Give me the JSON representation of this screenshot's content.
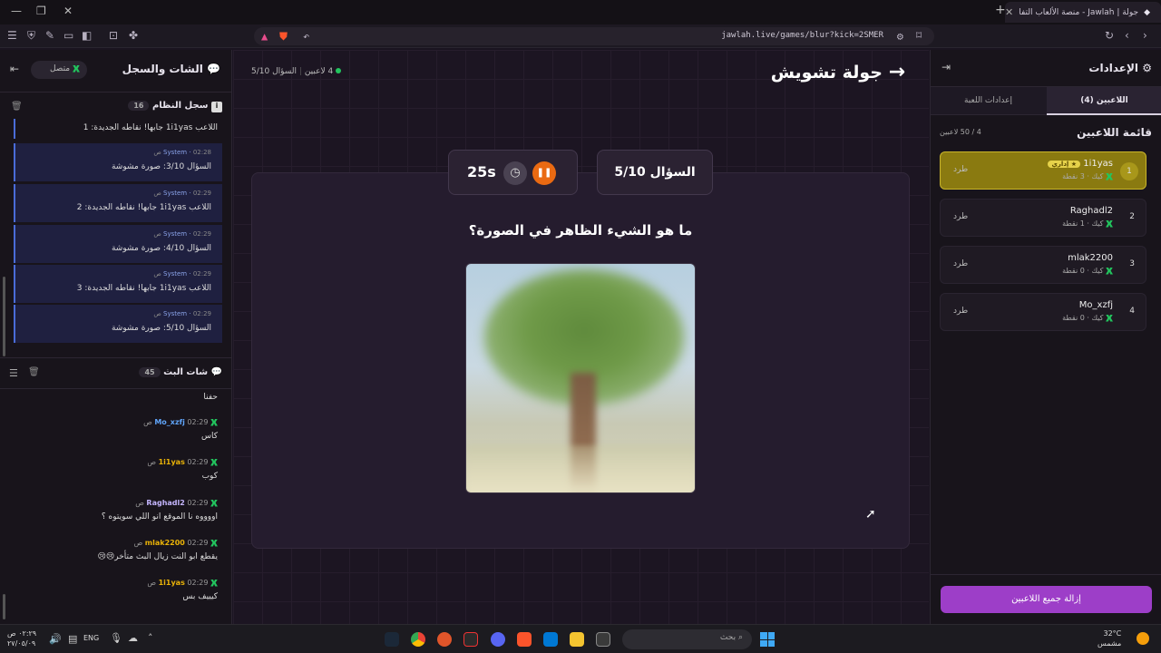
{
  "browser": {
    "tab_title": "جولة | Jawlah - منصة الألعاب التفا",
    "url": "jawlah.live/games/blur?kick=2SMER"
  },
  "settings": {
    "title": "الإعدادات",
    "tabs": [
      "اللاعبين (4)",
      "إعدادات اللعبة"
    ],
    "list_title": "قائمة اللاعبين",
    "count": "4 / 50 لاعبين",
    "players": [
      {
        "rank": "1",
        "name": "1i1yas",
        "badge": "إداري",
        "platform": "كيك",
        "points": "3 نقطة",
        "kick": "طرد"
      },
      {
        "rank": "2",
        "name": "Raghadl2",
        "platform": "كيك",
        "points": "1 نقطة",
        "kick": "طرد"
      },
      {
        "rank": "3",
        "name": "mlak2200",
        "platform": "كيك",
        "points": "0 نقطة",
        "kick": "طرد"
      },
      {
        "rank": "4",
        "name": "Mo_xzfj",
        "platform": "كيك",
        "points": "0 نقطة",
        "kick": "طرد"
      }
    ],
    "remove_all": "إزالة جميع اللاعبين"
  },
  "game": {
    "title": "جولة تشويش",
    "players_count": "4 لاعبين",
    "question_counter": "السؤال 5/10",
    "question_box": "السؤال 5/10",
    "timer": "25s",
    "question": "ما هو الشيء الظاهر في الصورة؟"
  },
  "chat": {
    "title": "الشات والسجل",
    "status": "متصل",
    "log_title": "سجل النظام",
    "log_count": "16",
    "log_first": "اللاعب 1i1yas جابها! نقاطه الجديدة: 1",
    "log": [
      {
        "sender": "System",
        "time": "02:28 ص",
        "text": "السؤال 3/10: صورة مشوشة"
      },
      {
        "sender": "System",
        "time": "02:29 ص",
        "text": "اللاعب 1i1yas جابها! نقاطه الجديدة: 2"
      },
      {
        "sender": "System",
        "time": "02:29 ص",
        "text": "السؤال 4/10: صورة مشوشة"
      },
      {
        "sender": "System",
        "time": "02:29 ص",
        "text": "اللاعب 1i1yas جابها! نقاطه الجديدة: 3"
      },
      {
        "sender": "System",
        "time": "02:29 ص",
        "text": "السؤال 5/10: صورة مشوشة"
      }
    ],
    "live_title": "شات البث",
    "live_count": "45",
    "live_first": "حفنا",
    "messages": [
      {
        "user": "Mo_xzfj",
        "time": "02:29 ص",
        "text": "كاس",
        "color": "#60a5fa"
      },
      {
        "user": "1i1yas",
        "time": "02:29 ص",
        "text": "كوب",
        "color": "#eab308"
      },
      {
        "user": "Raghadl2",
        "time": "02:29 ص",
        "text": "اووووه نا الموقع انو اللي سويتوه ؟",
        "color": "#c4b5fd"
      },
      {
        "user": "mlak2200",
        "time": "02:29 ص",
        "text": "يقطع ابو النت زيال البث متأخر😢😢",
        "color": "#eab308"
      },
      {
        "user": "1i1yas",
        "time": "02:29 ص",
        "text": "كيييف بس",
        "color": "#eab308"
      }
    ]
  },
  "taskbar": {
    "search": "بحث",
    "lang": "ENG",
    "time": "٠٢:٢٩ ص",
    "date": "٢٧/٠٥/٠٩",
    "temp": "32°C",
    "weather": "مشمس"
  },
  "colors": {
    "accent_purple": "#9d3ec8",
    "active_gold": "#8a7a10",
    "kick_green": "#22c55e",
    "pause_orange": "#ea6a12"
  }
}
